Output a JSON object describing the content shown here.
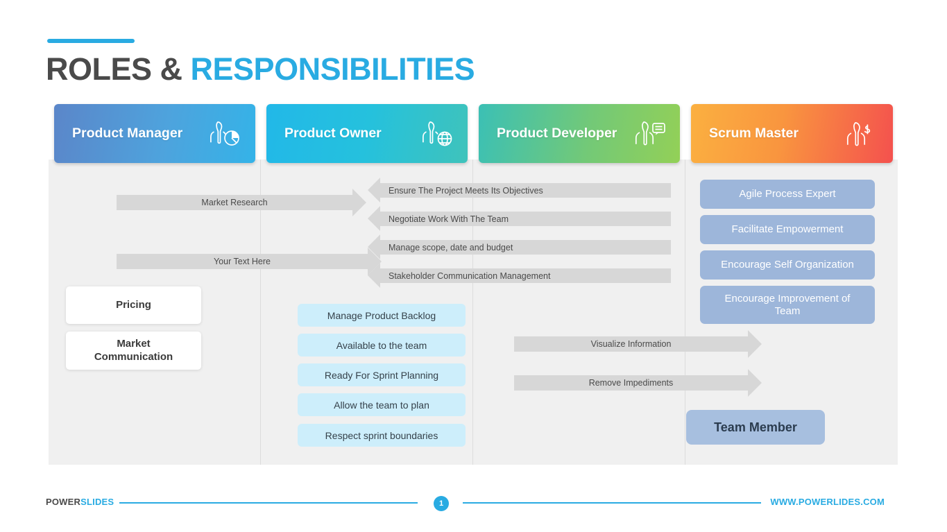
{
  "title": {
    "part_dark": "ROLES & ",
    "part_blue": "RESPONSIBILITIES"
  },
  "roles": [
    {
      "label": "Product Manager",
      "icon": "person-chart-icon",
      "accent": "#4ea3dd"
    },
    {
      "label": "Product Owner",
      "icon": "person-globe-icon",
      "accent": "#25c1dd"
    },
    {
      "label": "Product Developer",
      "icon": "person-chat-icon",
      "accent": "#73c977"
    },
    {
      "label": "Scrum Master",
      "icon": "person-dollar-icon",
      "accent": "#f9953f"
    }
  ],
  "product_manager": {
    "arrows": [
      {
        "text": "Market Research"
      },
      {
        "text": "Your Text Here"
      }
    ],
    "cards": [
      {
        "text": "Pricing"
      },
      {
        "text": "Market Communication"
      }
    ]
  },
  "product_owner": {
    "pills": [
      {
        "text": "Manage Product Backlog"
      },
      {
        "text": "Available to the team"
      },
      {
        "text": "Ready For Sprint Planning"
      },
      {
        "text": "Allow the team to plan"
      },
      {
        "text": "Respect sprint boundaries"
      }
    ]
  },
  "product_developer": {
    "left_arrows": [
      {
        "text": "Ensure The Project Meets Its Objectives"
      },
      {
        "text": "Negotiate Work With The Team"
      },
      {
        "text": "Manage scope, date and budget"
      },
      {
        "text": "Stakeholder Communication Management"
      }
    ],
    "right_arrows": [
      {
        "text": "Visualize Information"
      },
      {
        "text": "Remove Impediments"
      }
    ]
  },
  "scrum_master": {
    "pills": [
      {
        "text": "Agile Process Expert"
      },
      {
        "text": "Facilitate Empowerment"
      },
      {
        "text": "Encourage Self Organization"
      },
      {
        "text": "Encourage Improvement of Team"
      }
    ],
    "team_member": "Team Member"
  },
  "footer": {
    "logo_dark": "POWER",
    "logo_blue": "SLIDES",
    "page_number": "1",
    "url": "WWW.POWERLIDES.COM",
    "accent_color": "#29ABE2"
  }
}
